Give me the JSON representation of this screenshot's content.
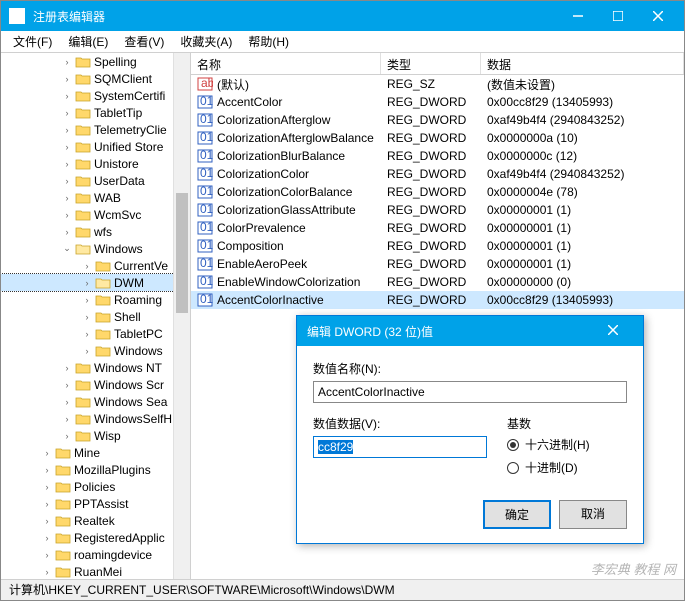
{
  "window": {
    "title": "注册表编辑器"
  },
  "menu": {
    "file": "文件(F)",
    "edit": "编辑(E)",
    "view": "查看(V)",
    "favorites": "收藏夹(A)",
    "help": "帮助(H)"
  },
  "columns": {
    "name": "名称",
    "type": "类型",
    "data": "数据"
  },
  "tree": [
    {
      "label": "Spelling",
      "depth": 2
    },
    {
      "label": "SQMClient",
      "depth": 2
    },
    {
      "label": "SystemCertifi",
      "depth": 2
    },
    {
      "label": "TabletTip",
      "depth": 2
    },
    {
      "label": "TelemetryClie",
      "depth": 2
    },
    {
      "label": "Unified Store",
      "depth": 2
    },
    {
      "label": "Unistore",
      "depth": 2
    },
    {
      "label": "UserData",
      "depth": 2
    },
    {
      "label": "WAB",
      "depth": 2
    },
    {
      "label": "WcmSvc",
      "depth": 2
    },
    {
      "label": "wfs",
      "depth": 2
    },
    {
      "label": "Windows",
      "depth": 2,
      "open": true
    },
    {
      "label": "CurrentVe",
      "depth": 3
    },
    {
      "label": "DWM",
      "depth": 3,
      "selected": true
    },
    {
      "label": "Roaming",
      "depth": 3
    },
    {
      "label": "Shell",
      "depth": 3
    },
    {
      "label": "TabletPC",
      "depth": 3
    },
    {
      "label": "Windows",
      "depth": 3
    },
    {
      "label": "Windows NT",
      "depth": 2
    },
    {
      "label": "Windows Scr",
      "depth": 2
    },
    {
      "label": "Windows Sea",
      "depth": 2
    },
    {
      "label": "WindowsSelfH",
      "depth": 2
    },
    {
      "label": "Wisp",
      "depth": 2
    },
    {
      "label": "Mine",
      "depth": 1
    },
    {
      "label": "MozillaPlugins",
      "depth": 1
    },
    {
      "label": "Policies",
      "depth": 1
    },
    {
      "label": "PPTAssist",
      "depth": 1
    },
    {
      "label": "Realtek",
      "depth": 1
    },
    {
      "label": "RegisteredApplic",
      "depth": 1
    },
    {
      "label": "roamingdevice",
      "depth": 1
    },
    {
      "label": "RuanMei",
      "depth": 1
    }
  ],
  "values": [
    {
      "name": "(默认)",
      "type": "REG_SZ",
      "data": "(数值未设置)",
      "icon": "str"
    },
    {
      "name": "AccentColor",
      "type": "REG_DWORD",
      "data": "0x00cc8f29 (13405993)",
      "icon": "bin"
    },
    {
      "name": "ColorizationAfterglow",
      "type": "REG_DWORD",
      "data": "0xaf49b4f4 (2940843252)",
      "icon": "bin"
    },
    {
      "name": "ColorizationAfterglowBalance",
      "type": "REG_DWORD",
      "data": "0x0000000a (10)",
      "icon": "bin"
    },
    {
      "name": "ColorizationBlurBalance",
      "type": "REG_DWORD",
      "data": "0x0000000c (12)",
      "icon": "bin"
    },
    {
      "name": "ColorizationColor",
      "type": "REG_DWORD",
      "data": "0xaf49b4f4 (2940843252)",
      "icon": "bin"
    },
    {
      "name": "ColorizationColorBalance",
      "type": "REG_DWORD",
      "data": "0x0000004e (78)",
      "icon": "bin"
    },
    {
      "name": "ColorizationGlassAttribute",
      "type": "REG_DWORD",
      "data": "0x00000001 (1)",
      "icon": "bin"
    },
    {
      "name": "ColorPrevalence",
      "type": "REG_DWORD",
      "data": "0x00000001 (1)",
      "icon": "bin"
    },
    {
      "name": "Composition",
      "type": "REG_DWORD",
      "data": "0x00000001 (1)",
      "icon": "bin"
    },
    {
      "name": "EnableAeroPeek",
      "type": "REG_DWORD",
      "data": "0x00000001 (1)",
      "icon": "bin"
    },
    {
      "name": "EnableWindowColorization",
      "type": "REG_DWORD",
      "data": "0x00000000 (0)",
      "icon": "bin"
    },
    {
      "name": "AccentColorInactive",
      "type": "REG_DWORD",
      "data": "0x00cc8f29 (13405993)",
      "icon": "bin",
      "selected": true
    }
  ],
  "dialog": {
    "title": "编辑 DWORD (32 位)值",
    "name_label": "数值名称(N):",
    "name_value": "AccentColorInactive",
    "data_label": "数值数据(V):",
    "data_value": "cc8f29",
    "base_label": "基数",
    "hex_label": "十六进制(H)",
    "dec_label": "十进制(D)",
    "ok": "确定",
    "cancel": "取消"
  },
  "statusbar": "计算机\\HKEY_CURRENT_USER\\SOFTWARE\\Microsoft\\Windows\\DWM",
  "watermark": "李宏典 教程 网"
}
